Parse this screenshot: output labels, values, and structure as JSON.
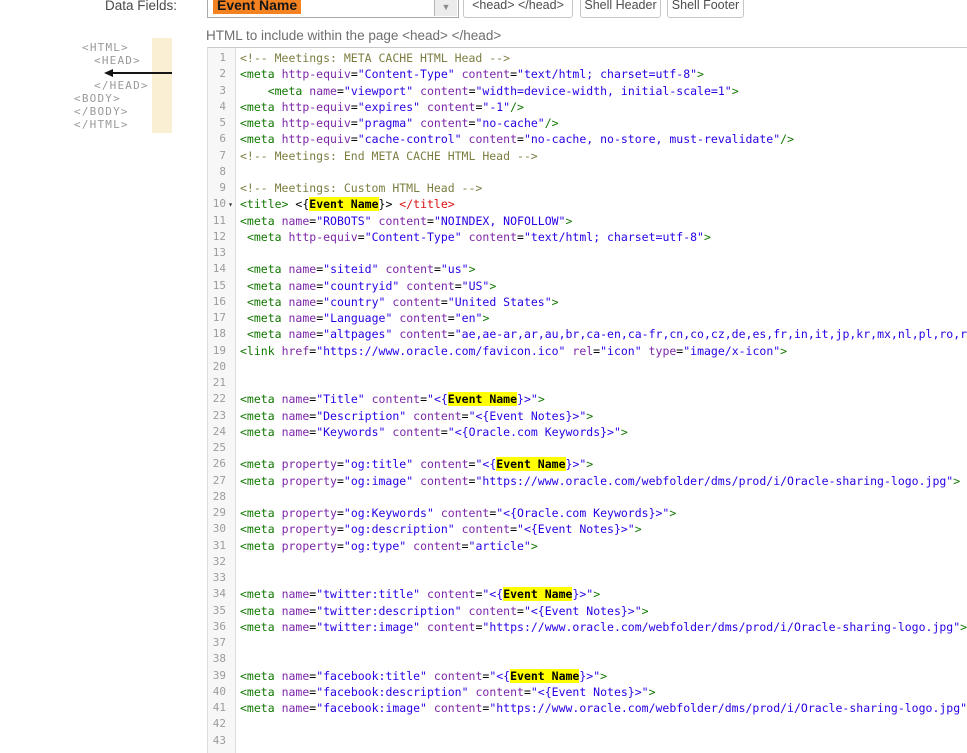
{
  "toolbar": {
    "data_fields_label": "Data Fields:",
    "dropdown_value": "Event Name",
    "buttons": [
      {
        "label": "<head> </head>"
      },
      {
        "label": "Shell Header"
      },
      {
        "label": "Shell Footer"
      }
    ]
  },
  "section": {
    "subtitle": "HTML to include within the page <head> </head>"
  },
  "diagram": {
    "lines": [
      "<HTML>",
      "<HEAD>",
      "</HEAD>",
      "<BODY>",
      "</BODY>",
      "</HTML>"
    ]
  },
  "colors": {
    "accent_orange": "#F48220",
    "highlight_yellow": "#FFFF00",
    "syntax": {
      "tag": "#117700",
      "attribute": "#7C26A8",
      "string": "#2A00E6",
      "comment": "#7D7D42",
      "error": "#DD1111",
      "text": "#000000"
    }
  },
  "editor": {
    "highlight_term": "Event Name",
    "fold_line": 10,
    "lines": [
      "<!-- Meetings: META CACHE HTML Head -->",
      "<meta http-equiv=\"Content-Type\" content=\"text/html; charset=utf-8\">",
      "    <meta name=\"viewport\" content=\"width=device-width, initial-scale=1\">",
      "<meta http-equiv=\"expires\" content=\"-1\"/>",
      "<meta http-equiv=\"pragma\" content=\"no-cache\"/>",
      "<meta http-equiv=\"cache-control\" content=\"no-cache, no-store, must-revalidate\"/>",
      "<!-- Meetings: End META CACHE HTML Head -->",
      "",
      "<!-- Meetings: Custom HTML Head -->",
      "<title> <{Event Name}> </title>",
      "<meta name=\"ROBOTS\" content=\"NOINDEX, NOFOLLOW\">",
      " <meta http-equiv=\"Content-Type\" content=\"text/html; charset=utf-8\">",
      "",
      " <meta name=\"siteid\" content=\"us\">",
      " <meta name=\"countryid\" content=\"US\">",
      " <meta name=\"country\" content=\"United States\">",
      " <meta name=\"Language\" content=\"en\">",
      " <meta name=\"altpages\" content=\"ae,ae-ar,ar,au,br,ca-en,ca-fr,cn,co,cz,de,es,fr,in,it,jp,kr,mx,nl,pl,ro,ru,se,tr,t",
      "<link href=\"https://www.oracle.com/favicon.ico\" rel=\"icon\" type=\"image/x-icon\">",
      "",
      "",
      "<meta name=\"Title\" content=\"<{Event Name}>\">",
      "<meta name=\"Description\" content=\"<{Event Notes}>\">",
      "<meta name=\"Keywords\" content=\"<{Oracle.com Keywords}>\">",
      "",
      "<meta property=\"og:title\" content=\"<{Event Name}>\">",
      "<meta property=\"og:image\" content=\"https://www.oracle.com/webfolder/dms/prod/i/Oracle-sharing-logo.jpg\">",
      "",
      "<meta property=\"og:Keywords\" content=\"<{Oracle.com Keywords}>\">",
      "<meta property=\"og:description\" content=\"<{Event Notes}>\">",
      "<meta property=\"og:type\" content=\"article\">",
      "",
      "",
      "<meta name=\"twitter:title\" content=\"<{Event Name}>\">",
      "<meta name=\"twitter:description\" content=\"<{Event Notes}>\">",
      "<meta name=\"twitter:image\" content=\"https://www.oracle.com/webfolder/dms/prod/i/Oracle-sharing-logo.jpg\">",
      "",
      "",
      "<meta name=\"facebook:title\" content=\"<{Event Name}>\">",
      "<meta name=\"facebook:description\" content=\"<{Event Notes}>\">",
      "<meta name=\"facebook:image\" content=\"https://www.oracle.com/webfolder/dms/prod/i/Oracle-sharing-logo.jpg\">",
      "",
      ""
    ]
  }
}
